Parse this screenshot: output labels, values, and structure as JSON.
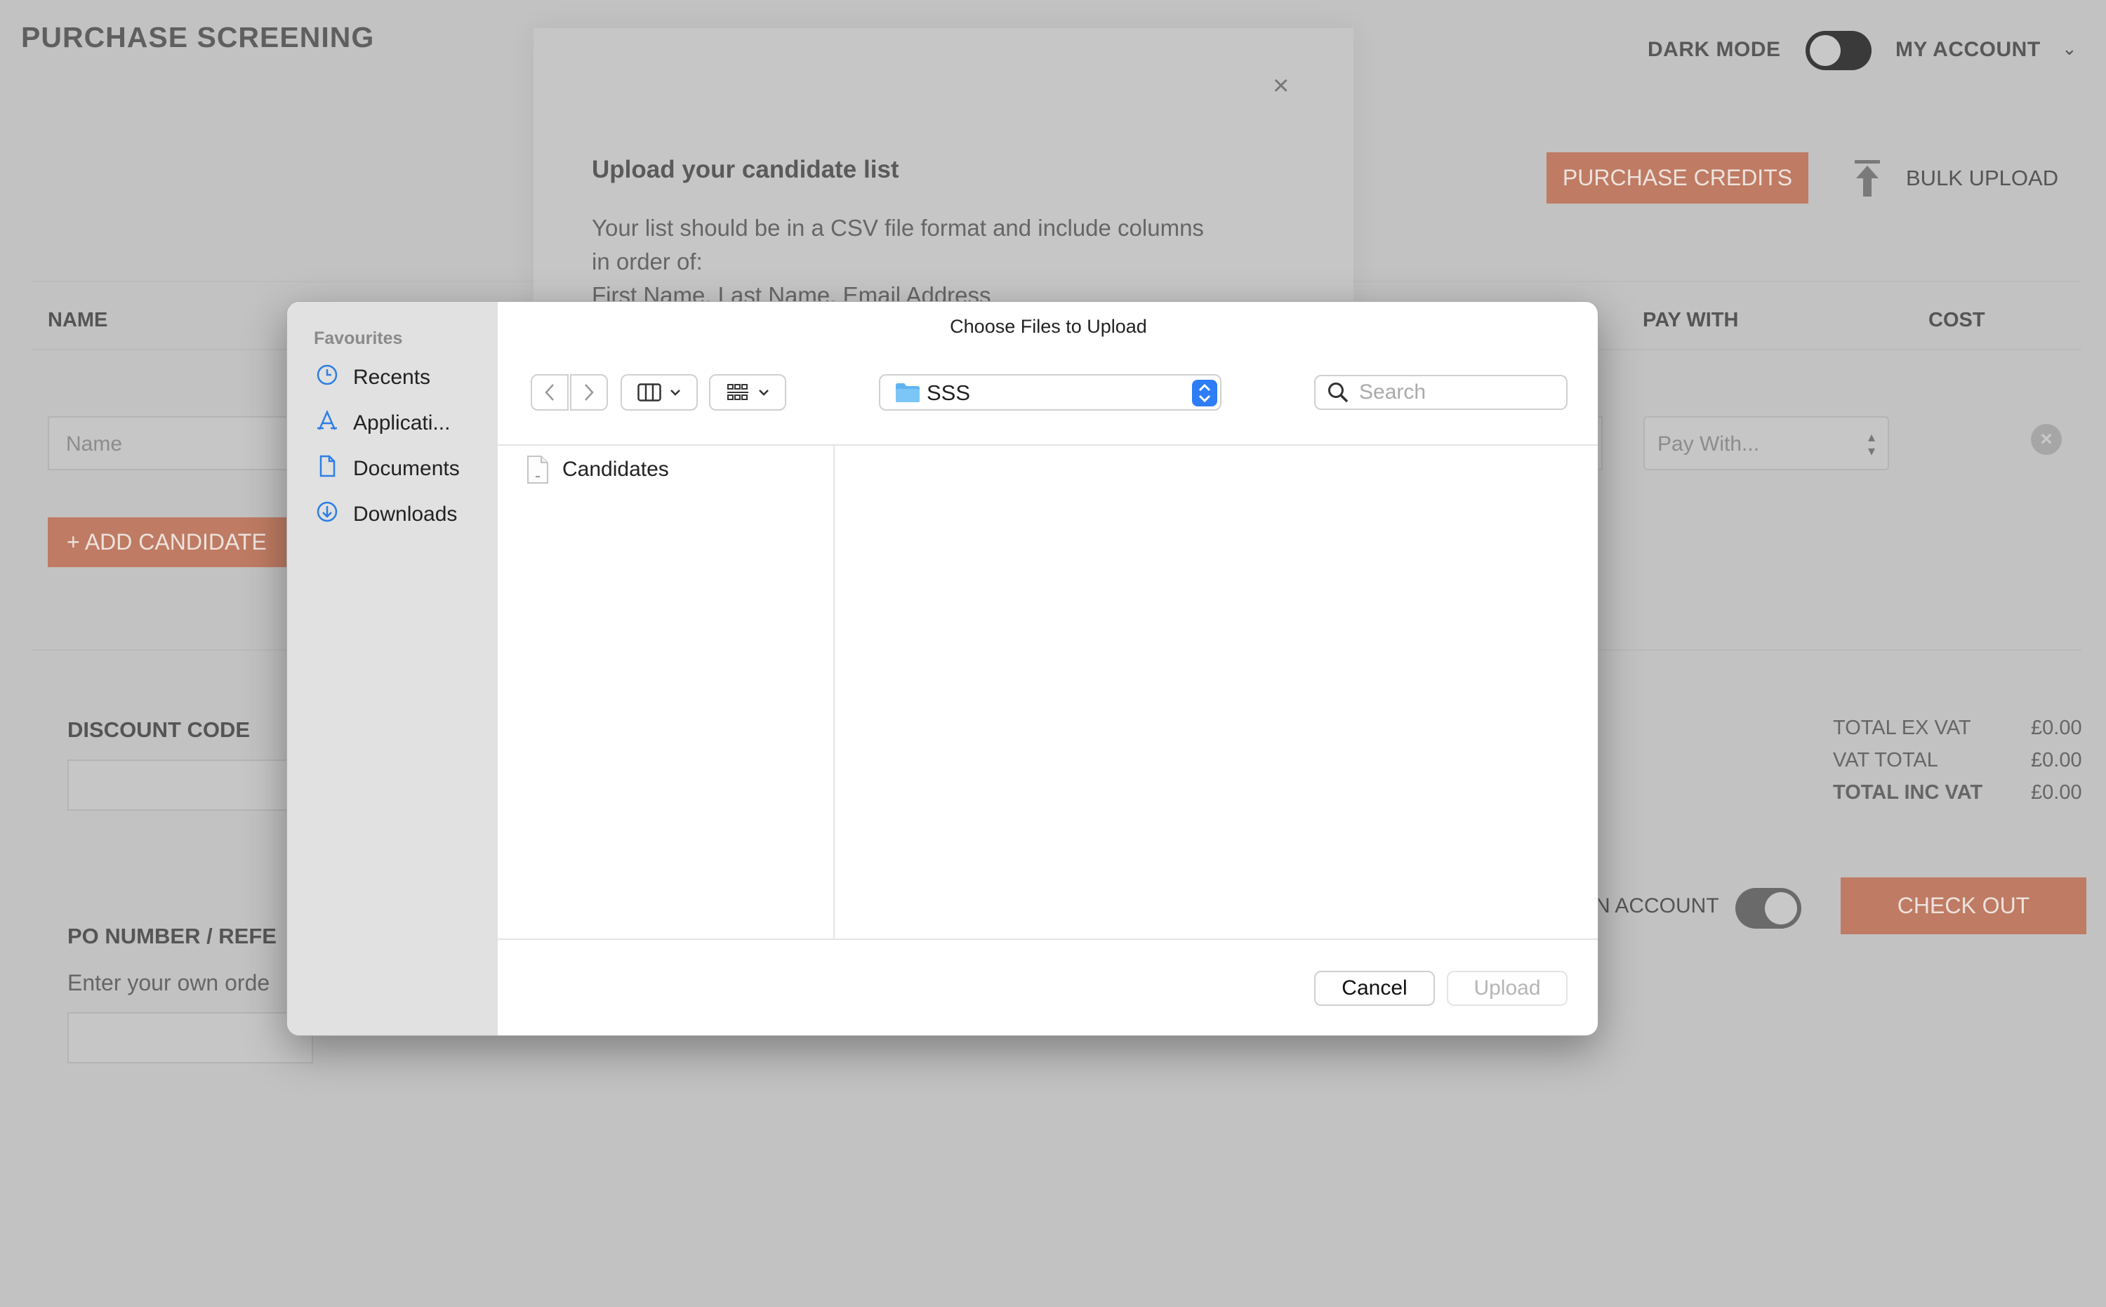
{
  "page": {
    "title": "PURCHASE SCREENING",
    "dark_mode_label": "DARK MODE",
    "my_account_label": "MY ACCOUNT",
    "purchase_credits_label": "PURCHASE CREDITS",
    "bulk_upload_label": "BULK UPLOAD",
    "columns": {
      "name": "NAME",
      "pay_with": "PAY WITH",
      "cost": "COST"
    },
    "name_placeholder": "Name",
    "pay_with_placeholder": "Pay With...",
    "add_candidate_label": "+ ADD CANDIDATE",
    "discount_code_label": "DISCOUNT CODE",
    "po_number_label": "PO NUMBER / REFE",
    "po_number_hint": "Enter your own orde",
    "account_toggle_label": "N ACCOUNT",
    "checkout_label": "CHECK OUT",
    "summary": [
      {
        "label": "TOTAL EX VAT",
        "value": "£0.00"
      },
      {
        "label": "VAT TOTAL",
        "value": "£0.00"
      },
      {
        "label": "TOTAL INC VAT",
        "value": "£0.00"
      }
    ],
    "accent_color": "#bf7b63"
  },
  "upload_modal": {
    "title": "Upload your candidate list",
    "text_line1": "Your list should be in a CSV file format and include columns",
    "text_line2": "in order of:",
    "text_line3": "First Name, Last Name, Email Address"
  },
  "file_dialog": {
    "title": "Choose Files to Upload",
    "favourites_label": "Favourites",
    "sidebar": [
      {
        "label": "Recents",
        "icon": "clock-icon"
      },
      {
        "label": "Applicati...",
        "icon": "applications-icon"
      },
      {
        "label": "Documents",
        "icon": "document-icon"
      },
      {
        "label": "Downloads",
        "icon": "download-icon"
      }
    ],
    "current_folder": "SSS",
    "search_placeholder": "Search",
    "files": [
      {
        "name": "Candidates",
        "icon": "file-icon"
      }
    ],
    "cancel_label": "Cancel",
    "upload_label": "Upload"
  }
}
